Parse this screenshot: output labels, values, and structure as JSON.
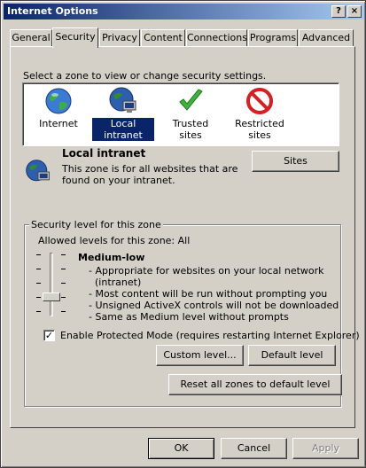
{
  "window": {
    "title": "Internet Options",
    "help_label": "?",
    "close_label": "×"
  },
  "tabs": [
    "General",
    "Security",
    "Privacy",
    "Content",
    "Connections",
    "Programs",
    "Advanced"
  ],
  "select_zone_text": "Select a zone to view or change security settings.",
  "zones": [
    {
      "label": "Internet",
      "icon": "globe-icon"
    },
    {
      "label": "Local intranet",
      "icon": "intranet-icon",
      "selected": true
    },
    {
      "label": "Trusted sites",
      "icon": "checkmark-icon"
    },
    {
      "label": "Restricted sites",
      "icon": "restricted-icon"
    }
  ],
  "zone_info": {
    "title": "Local intranet",
    "desc_line1": "This zone is for all websites that are",
    "desc_line2": "found on your intranet.",
    "sites_button": "Sites"
  },
  "security_level": {
    "group_label": "Security level for this zone",
    "allowed_text": "Allowed levels for this zone: All",
    "level_name": "Medium-low",
    "bullets": [
      "- Appropriate for websites on your local network",
      "(intranet)",
      "- Most content will be run without prompting you",
      "- Unsigned ActiveX controls will not be downloaded",
      "- Same as Medium level without prompts"
    ],
    "protected_mode_label": "Enable Protected Mode (requires restarting Internet Explorer)",
    "protected_mode_checked": "✓",
    "custom_level_button": "Custom level...",
    "default_level_button": "Default level"
  },
  "reset_all_button": "Reset all zones to default level",
  "footer": {
    "ok": "OK",
    "cancel": "Cancel",
    "apply": "Apply"
  }
}
